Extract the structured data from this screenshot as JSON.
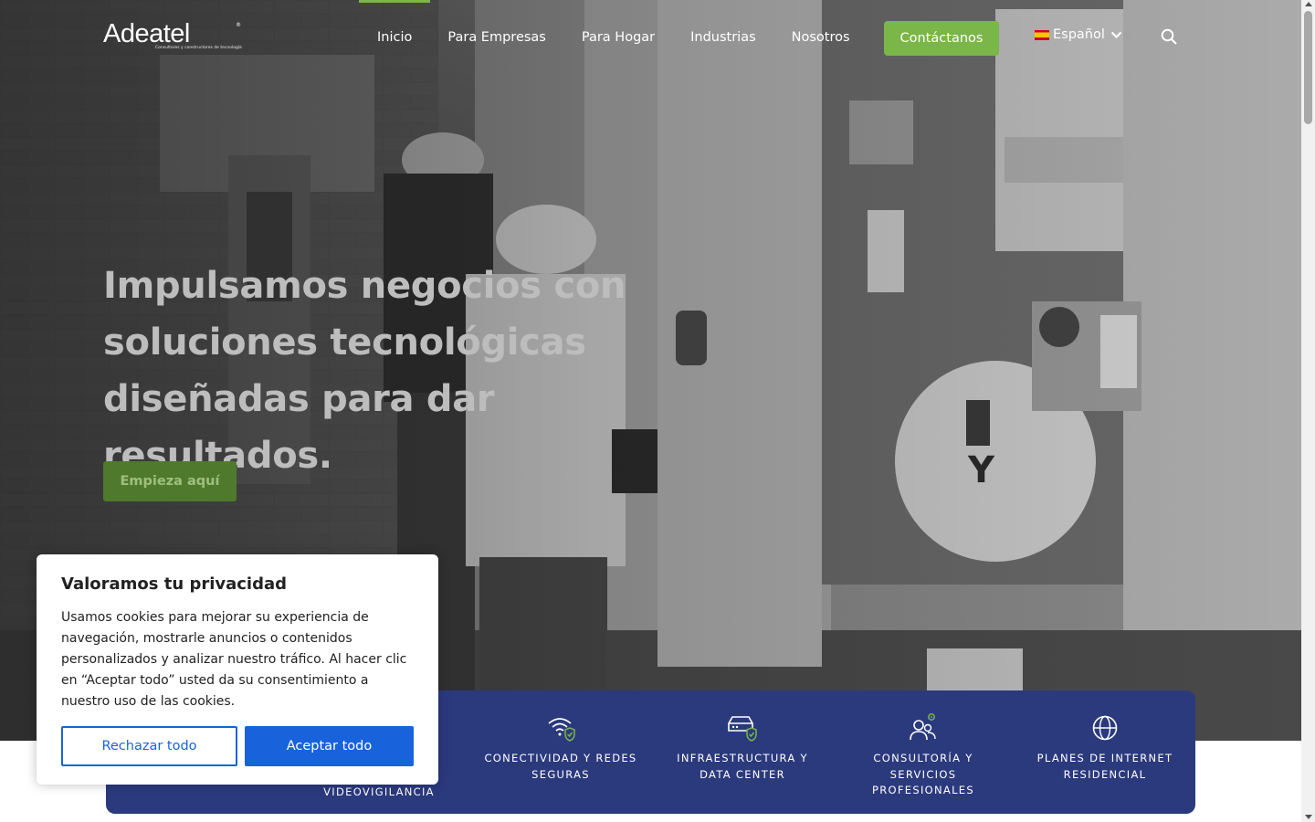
{
  "brand": {
    "logo_text": "Adeatel",
    "logo_mark": "®",
    "logo_tagline": "Consultores y constructores de tecnología"
  },
  "nav": {
    "items": [
      {
        "label": "Inicio",
        "active": true
      },
      {
        "label": "Para Empresas",
        "active": false
      },
      {
        "label": "Para Hogar",
        "active": false
      },
      {
        "label": "Industrias",
        "active": false
      },
      {
        "label": "Nosotros",
        "active": false
      }
    ],
    "contact_label": "Contáctanos",
    "language_label": "Español",
    "icons": {
      "search": "search-icon",
      "chevron": "chevron-down-icon",
      "flag": "spain-flag-icon"
    }
  },
  "hero": {
    "title_line1": "Impulsamos negocios con",
    "title_line2": "soluciones tecnológicas",
    "title_line3": "diseñadas para dar resultados.",
    "cta_label": "Empieza aquí"
  },
  "services": [
    {
      "line1": "",
      "line2": "VIDEOVIGILANCIA",
      "icon": "camera-icon"
    },
    {
      "line1": "CONECTIVIDAD Y REDES",
      "line2": "SEGURAS",
      "icon": "secure-wifi-icon"
    },
    {
      "line1": "INFRAESTRUCTURA Y",
      "line2": "DATA CENTER",
      "icon": "secure-server-icon"
    },
    {
      "line1": "CONSULTORÍA Y",
      "line2": "SERVICIOS",
      "line3": "PROFESIONALES",
      "icon": "team-gear-icon"
    },
    {
      "line1": "PLANES DE INTERNET",
      "line2": "RESIDENCIAL",
      "icon": "globe-icon"
    }
  ],
  "cookie": {
    "title": "Valoramos tu privacidad",
    "text": "Usamos cookies para mejorar su experiencia de navegación, mostrarle anuncios o contenidos personalizados y analizar nuestro tráfico. Al hacer clic en “Aceptar todo” usted da su consentimiento a nuestro uso de las cookies.",
    "reject_label": "Rechazar todo",
    "accept_label": "Aceptar todo"
  },
  "colors": {
    "accent_green": "#7ab648",
    "services_bg": "#2b3a7d",
    "cookie_blue": "#1863dc"
  }
}
